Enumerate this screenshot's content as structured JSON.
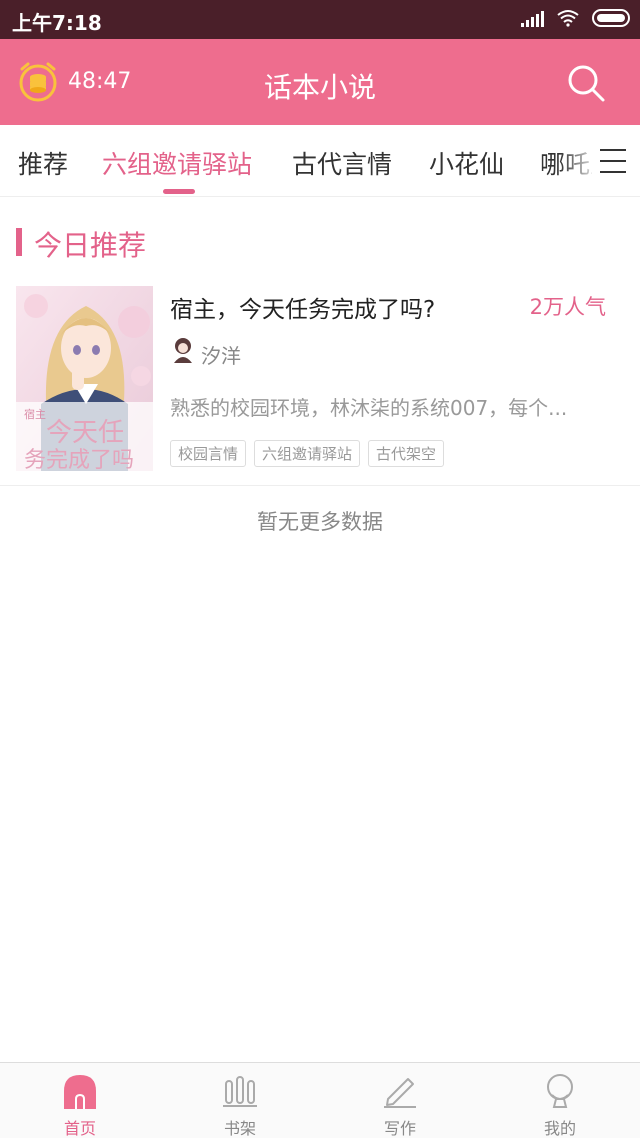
{
  "status_bar": {
    "time": "上午7:18"
  },
  "header": {
    "timer": "48:47",
    "title": "话本小说"
  },
  "tabs": [
    {
      "label": "推荐"
    },
    {
      "label": "六组邀请驿站"
    },
    {
      "label": "古代言情"
    },
    {
      "label": "小花仙"
    },
    {
      "label": "哪吒之"
    }
  ],
  "active_tab": "六组邀请驿站",
  "section": {
    "title": "今日推荐"
  },
  "books": [
    {
      "title": "宿主，今天任务完成了吗?",
      "popularity": "2万人气",
      "author": "汐洋",
      "description": "熟悉的校园环境，林沐柒的系统007，每个...",
      "tags": [
        "校园言情",
        "六组邀请驿站",
        "古代架空"
      ],
      "cover_text": [
        "宿主",
        "今天任",
        "务完成了吗"
      ]
    }
  ],
  "footer_message": "暂无更多数据",
  "bottom_nav": [
    {
      "label": "首页",
      "icon": "home-icon"
    },
    {
      "label": "书架",
      "icon": "bookshelf-icon"
    },
    {
      "label": "写作",
      "icon": "pencil-icon"
    },
    {
      "label": "我的",
      "icon": "profile-icon"
    }
  ],
  "colors": {
    "accent": "#e3628a",
    "header_bg": "#ee6d8e",
    "status_bg": "#4a1f29"
  }
}
